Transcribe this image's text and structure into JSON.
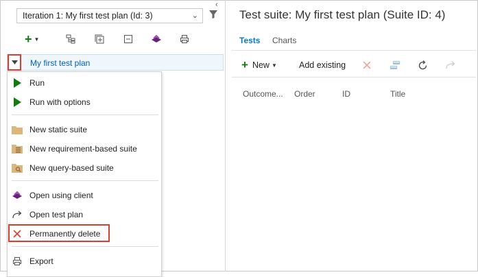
{
  "left": {
    "iteration_select": "Iteration 1: My first test plan (Id: 3)",
    "plan_label": "My first test plan"
  },
  "menu": {
    "items": [
      {
        "label": "Run",
        "icon": "play-icon"
      },
      {
        "label": "Run with options",
        "icon": "play-icon"
      },
      {
        "label": "New static suite",
        "icon": "folder-icon"
      },
      {
        "label": "New requirement-based suite",
        "icon": "requirement-suite-icon"
      },
      {
        "label": "New query-based suite",
        "icon": "query-suite-icon"
      },
      {
        "label": "Open using client",
        "icon": "client-icon"
      },
      {
        "label": "Open test plan",
        "icon": "open-arrow-icon"
      },
      {
        "label": "Permanently delete",
        "icon": "delete-x-icon"
      },
      {
        "label": "Export",
        "icon": "print-icon"
      }
    ]
  },
  "right": {
    "title": "Test suite: My first test plan (Suite ID: 4)",
    "tabs": [
      "Tests",
      "Charts"
    ],
    "toolbar": {
      "new_label": "New",
      "add_existing_label": "Add existing"
    },
    "columns": [
      "Outcome...",
      "Order",
      "ID",
      "Title"
    ]
  },
  "colors": {
    "accent": "#0078d4",
    "highlight_border": "#e23b2e",
    "play": "#107c10",
    "delete": "#e23b2e"
  }
}
